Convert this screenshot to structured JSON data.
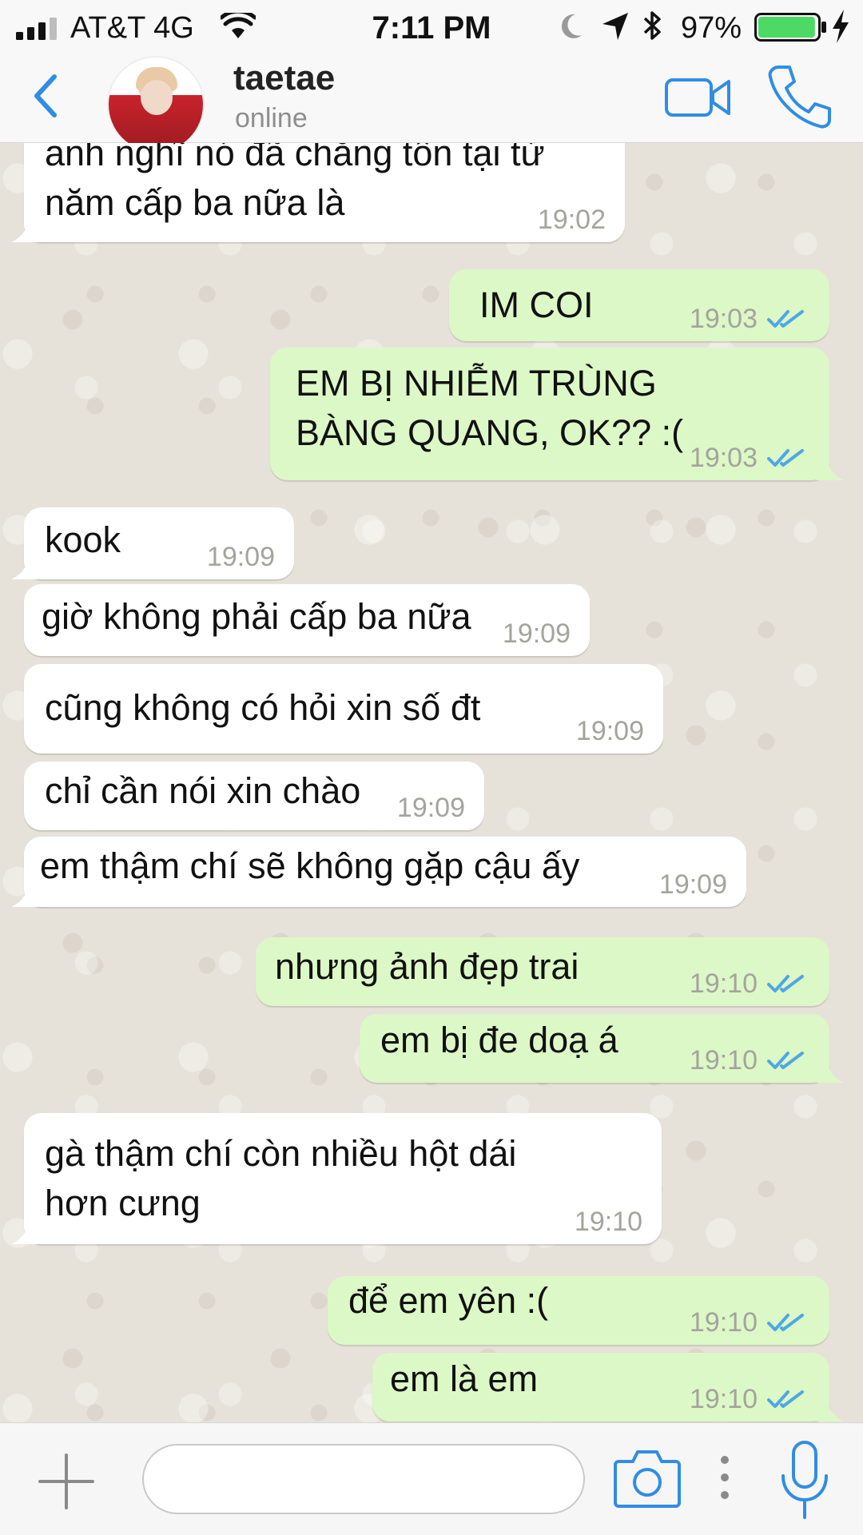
{
  "status_bar": {
    "carrier": "AT&T 4G",
    "time": "7:11 PM",
    "battery_percent": "97%",
    "battery_level": 0.97,
    "icons": [
      "signal-icon",
      "wifi-icon",
      "moon-icon",
      "location-icon",
      "bluetooth-icon",
      "battery-icon",
      "charging-icon"
    ]
  },
  "header": {
    "contact_name": "taetae",
    "contact_status": "online",
    "icons": [
      "back-icon",
      "avatar",
      "video-call-icon",
      "phone-call-icon"
    ]
  },
  "colors": {
    "incoming_bubble": "#ffffff",
    "outgoing_bubble": "#dcf8c6",
    "read_ticks": "#4fa7e3",
    "accent": "#2f8de4",
    "chat_background": "#e7e2d9"
  },
  "messages": [
    {
      "direction": "in",
      "text": "anh nghĩ nó đã chẳng tồn tại từ\nnăm cấp ba nữa là",
      "time": "19:02"
    },
    {
      "direction": "out",
      "text": "IM COI",
      "time": "19:03",
      "read": true
    },
    {
      "direction": "out",
      "text": "EM BỊ NHIỄM TRÙNG\nBÀNG QUANG, OK?? :(",
      "time": "19:03",
      "read": true
    },
    {
      "direction": "in",
      "text": "kook",
      "time": "19:09"
    },
    {
      "direction": "in",
      "text": "giờ không phải cấp ba nữa",
      "time": "19:09"
    },
    {
      "direction": "in",
      "text": "cũng không có hỏi xin số đt",
      "time": "19:09"
    },
    {
      "direction": "in",
      "text": "chỉ cần nói xin chào",
      "time": "19:09"
    },
    {
      "direction": "in",
      "text": "em thậm chí sẽ không gặp cậu ấy",
      "time": "19:09"
    },
    {
      "direction": "out",
      "text": "nhưng ảnh đẹp trai",
      "time": "19:10",
      "read": true
    },
    {
      "direction": "out",
      "text": "em bị đe doạ á",
      "time": "19:10",
      "read": true
    },
    {
      "direction": "in",
      "text": "gà thậm chí còn nhiều hột dái\nhơn cưng",
      "time": "19:10"
    },
    {
      "direction": "out",
      "text": "để em yên :(",
      "time": "19:10",
      "read": true
    },
    {
      "direction": "out",
      "text": "em là em",
      "time": "19:10",
      "read": true
    }
  ],
  "input_bar": {
    "message_value": "",
    "message_placeholder": "",
    "icons": [
      "plus-icon",
      "camera-icon",
      "more-icon",
      "microphone-icon"
    ]
  }
}
